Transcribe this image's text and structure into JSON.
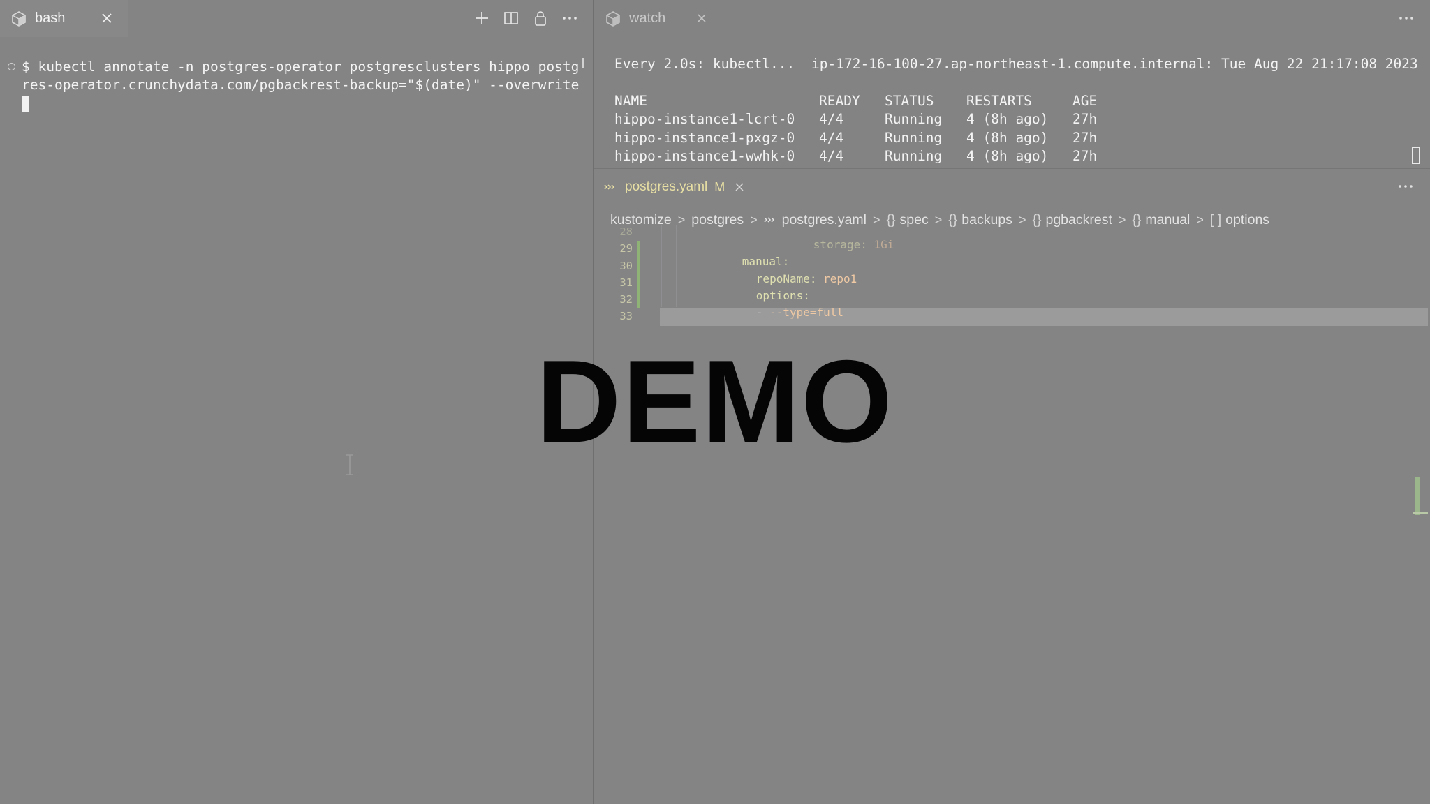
{
  "left_pane": {
    "tab": {
      "label": "bash",
      "icon": "terminal-cube-icon"
    },
    "toolbar_icons": [
      "plus-icon",
      "split-icon",
      "lock-icon",
      "more-icon"
    ],
    "terminal": {
      "line1": "$ kubectl annotate -n postgres-operator postgresclusters hippo postg",
      "line2": "res-operator.crunchydata.com/pgbackrest-backup=\"$(date)\" --overwrite"
    }
  },
  "watch_pane": {
    "tab": {
      "label": "watch",
      "icon": "terminal-cube-icon"
    },
    "header_cmd": "Every 2.0s: kubectl...",
    "header_host": "ip-172-16-100-27.ap-northeast-1.compute.internal: Tue Aug 22 21:17:08 2023",
    "columns": [
      "NAME",
      "READY",
      "STATUS",
      "RESTARTS",
      "AGE"
    ],
    "rows": [
      [
        "hippo-instance1-lcrt-0",
        "4/4",
        "Running",
        "4 (8h ago)",
        "27h"
      ],
      [
        "hippo-instance1-pxgz-0",
        "4/4",
        "Running",
        "4 (8h ago)",
        "27h"
      ],
      [
        "hippo-instance1-wwhk-0",
        "4/4",
        "Running",
        "4 (8h ago)",
        "27h"
      ]
    ]
  },
  "editor": {
    "tab": {
      "label": "postgres.yaml",
      "modified": "M",
      "icon": "yaml-file-icon"
    },
    "breadcrumb": {
      "b0": "kustomize",
      "b1": "postgres",
      "b2": "postgres.yaml",
      "b3": "spec",
      "b4": "backups",
      "b5": "pgbackrest",
      "b6": "manual",
      "b7": "options"
    },
    "breadcrumb_symbols": {
      "object": "{}",
      "array": "[ ]"
    },
    "line_numbers": [
      "28",
      "29",
      "30",
      "31",
      "32",
      "33"
    ],
    "code": {
      "l28_key": "storage:",
      "l28_val": "1Gi",
      "l29_key": "manual:",
      "l30_key": "repoName:",
      "l30_val": "repo1",
      "l31_key": "options:",
      "l32_dash": "-",
      "l32_val": "--type=full"
    }
  },
  "watermark": "DEMO",
  "colors": {
    "background": "#838384",
    "yaml_key": "#dfe0b0",
    "yaml_value": "#efc9a3",
    "git_added": "#8fb276",
    "tab_modified": "#e7dfa3"
  }
}
